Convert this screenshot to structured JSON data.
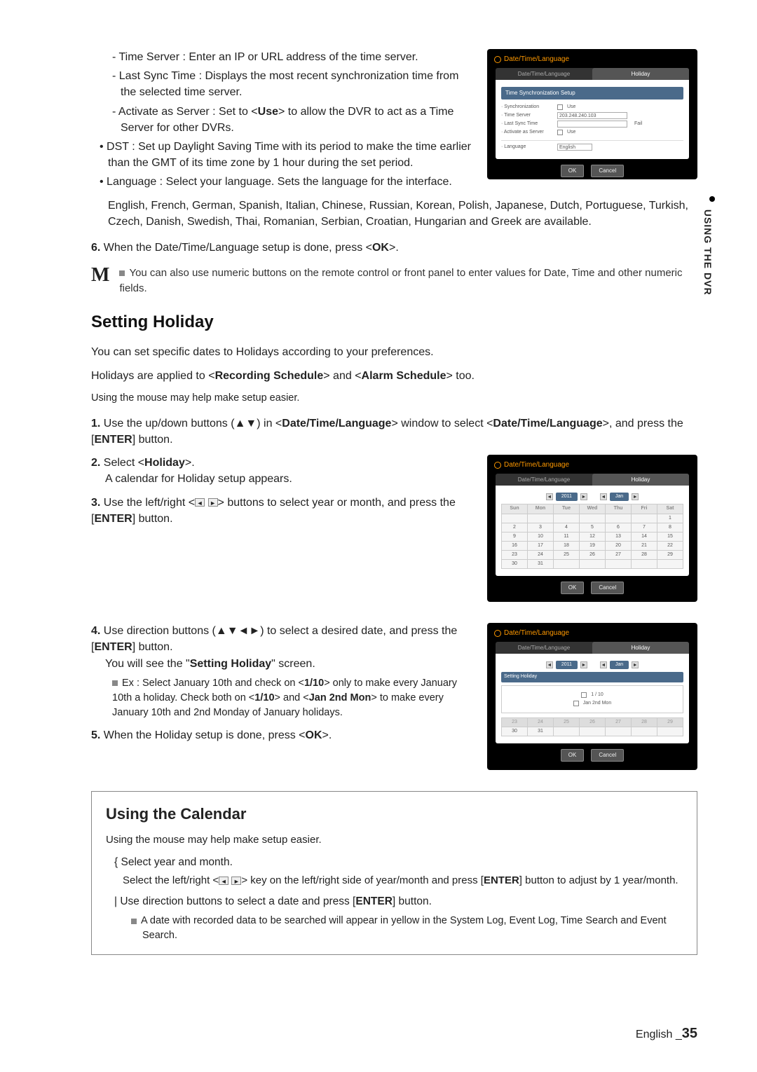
{
  "side_tab": "USING THE DVR",
  "top_block": {
    "dash_items": [
      "Time Server : Enter an IP or URL address of the time server.",
      "Last Sync Time : Displays the most recent synchronization time from the selected time server.",
      "Activate as Server : Set to <Use> to allow the DVR to act as a Time Server for other DVRs."
    ],
    "bullet_items": [
      "DST : Set up Daylight Saving Time with its period to make the time earlier than the GMT of its time zone by 1 hour during the set period.",
      "Language : Select your language. Sets the language for the interface."
    ],
    "lang_list": "English, French, German, Spanish, Italian, Chinese, Russian, Korean, Polish, Japanese, Dutch, Portuguese, Turkish, Czech, Danish, Swedish, Thai, Romanian, Serbian, Croatian, Hungarian and Greek are available.",
    "step6_num": "6.",
    "step6_text": "When the Date/Time/Language setup is done, press <OK>.",
    "note_icon": "M",
    "note_text": "You can also use numeric buttons on the remote control or front panel to enter values for Date, Time and other numeric fields."
  },
  "panel1": {
    "title": "Date/Time/Language",
    "tab1": "Date/Time/Language",
    "tab2": "Holiday",
    "sync_header": "Time Synchronization Setup",
    "rows": {
      "sync": "· Synchronization",
      "sync_val": "Use",
      "ts": "· Time Server",
      "ts_val": "203.248.240.103",
      "lst": "· Last Sync Time",
      "lst_status": "Fail",
      "act": "· Activate as Server",
      "act_val": "Use",
      "lang": "· Language",
      "lang_val": "English"
    },
    "ok": "OK",
    "cancel": "Cancel"
  },
  "setting_holiday": {
    "heading": "Setting Holiday",
    "intro1": "You can set specific dates to Holidays according to your preferences.",
    "intro2": "Holidays are applied to <Recording Schedule> and <Alarm Schedule> too.",
    "mouse": "Using the mouse may help make setup easier.",
    "step1": "Use the up/down buttons (▲▼) in <Date/Time/Language> window to select <Date/Time/Language>, and press the [ENTER] button.",
    "step2a": "Select <Holiday>.",
    "step2b": "A calendar for Holiday setup appears.",
    "step3": "Use the left/right < ◄ ► > buttons to select year or month, and press the [ENTER] button.",
    "step4a": "Use direction buttons (▲▼◄►) to select a desired date, and press the [ENTER] button.",
    "step4b": "You will see the \"Setting Holiday\" screen.",
    "step4ex": "Ex : Select January 10th and check on <1/10> only to make every January 10th a holiday. Check both on <1/10> and <Jan 2nd Mon> to make every January 10th and 2nd Monday of January holidays.",
    "step5": "When the Holiday setup is done, press <OK>."
  },
  "panel2": {
    "title": "Date/Time/Language",
    "tab1": "Date/Time/Language",
    "tab2": "Holiday",
    "year": "2011",
    "month": "Jan",
    "ok": "OK",
    "cancel": "Cancel"
  },
  "chart_data": {
    "type": "table",
    "title": "Calendar January 2011",
    "headers": [
      "Sun",
      "Mon",
      "Tue",
      "Wed",
      "Thu",
      "Fri",
      "Sat"
    ],
    "rows": [
      [
        "",
        "",
        "",
        "",
        "",
        "",
        "1"
      ],
      [
        "2",
        "3",
        "4",
        "5",
        "6",
        "7",
        "8"
      ],
      [
        "9",
        "10",
        "11",
        "12",
        "13",
        "14",
        "15"
      ],
      [
        "16",
        "17",
        "18",
        "19",
        "20",
        "21",
        "22"
      ],
      [
        "23",
        "24",
        "25",
        "26",
        "27",
        "28",
        "29"
      ],
      [
        "30",
        "31",
        "",
        "",
        "",
        "",
        ""
      ]
    ]
  },
  "panel3": {
    "title": "Date/Time/Language",
    "tab1": "Date/Time/Language",
    "tab2": "Holiday",
    "year": "2011",
    "month": "Jan",
    "setting_bar": "Setting Holiday",
    "opt1": "1 / 10",
    "opt2": "Jan 2nd Mon",
    "row1": [
      "23",
      "24",
      "25",
      "26",
      "27",
      "28",
      "29"
    ],
    "row2": [
      "30",
      "31",
      "",
      "",
      "",
      "",
      ""
    ],
    "ok": "OK",
    "cancel": "Cancel"
  },
  "calendar_box": {
    "heading": "Using the Calendar",
    "mouse": "Using the mouse may help make setup easier.",
    "item1": "Select year and month.",
    "item1_sub": "Select the left/right < ◄ ► > key on the left/right side of year/month and press [ENTER] button to adjust by 1 year/month.",
    "item2": "Use direction buttons to select a date and press [ENTER] button.",
    "item2_note": "A date with recorded data to be searched will appear in yellow in the System Log, Event Log, Time Search and Event Search."
  },
  "footer": {
    "lang": "English",
    "sep": "_",
    "page": "35"
  }
}
